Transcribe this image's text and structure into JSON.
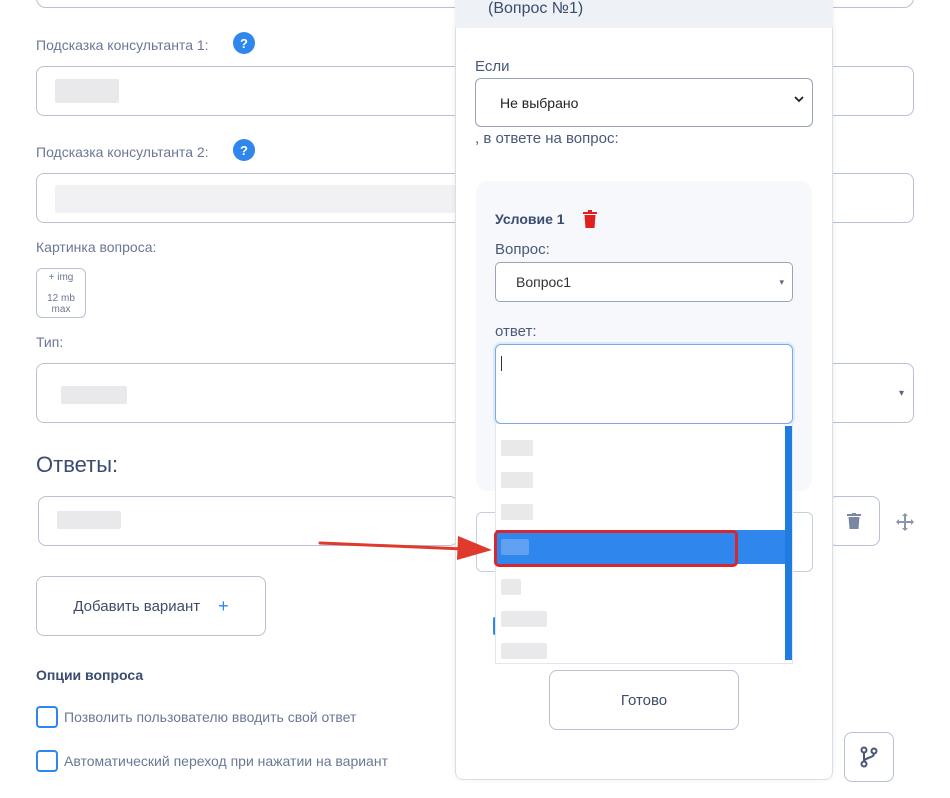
{
  "left_form": {
    "hint1_label": "Подсказка консультанта 1:",
    "hint2_label": "Подсказка консультанта 2:",
    "help_mark": "?",
    "image_label": "Картинка вопроса:",
    "image_upload": {
      "line1": "+ img",
      "line2": "12 mb",
      "line3": "max"
    },
    "type_label": "Тип:",
    "answers_title": "Ответы:",
    "add_variant_label": "Добавить вариант",
    "add_variant_plus": "+",
    "options_title": "Опции вопроса",
    "option1_label": "Позволить пользователю вводить свой ответ",
    "option2_label": "Автоматический переход при нажатии на вариант"
  },
  "modal": {
    "header_title": "(Вопрос №1)",
    "if_label": "Если",
    "if_select_value": "Не выбрано",
    "in_answer_label": ", в ответе на вопрос:",
    "condition_title": "Условие 1",
    "question_label": "Вопрос:",
    "question_value": "Вопрос1",
    "answer_label": "ответ:",
    "answer_value": "",
    "done_label": "Готово"
  },
  "colors": {
    "accent": "#2f86ec",
    "highlight": "#d8262f",
    "border": "#b8c1d3",
    "text_dark": "#3a4c6f",
    "text_muted": "#6a7895"
  }
}
